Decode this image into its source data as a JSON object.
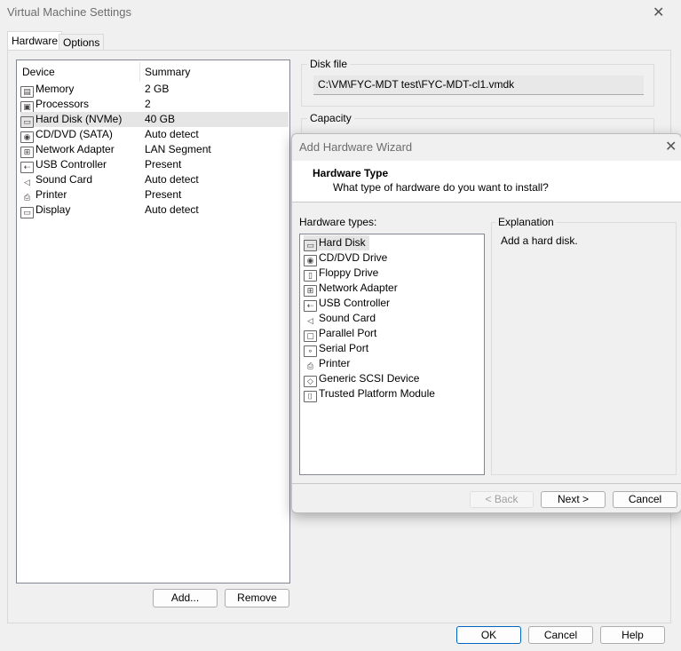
{
  "window": {
    "title": "Virtual Machine Settings",
    "close_icon": "close-icon"
  },
  "tabs": [
    {
      "label": "Hardware",
      "selected": true
    },
    {
      "label": "Options",
      "selected": false
    }
  ],
  "device_list": {
    "columns": [
      "Device",
      "Summary"
    ],
    "rows": [
      {
        "icon": "memory-icon",
        "device": "Memory",
        "summary": "2 GB"
      },
      {
        "icon": "processor-icon",
        "device": "Processors",
        "summary": "2"
      },
      {
        "icon": "hard-disk-icon",
        "device": "Hard Disk (NVMe)",
        "summary": "40 GB",
        "selected": true
      },
      {
        "icon": "cd-dvd-icon",
        "device": "CD/DVD (SATA)",
        "summary": "Auto detect"
      },
      {
        "icon": "network-adapter-icon",
        "device": "Network Adapter",
        "summary": "LAN Segment"
      },
      {
        "icon": "usb-icon",
        "device": "USB Controller",
        "summary": "Present"
      },
      {
        "icon": "sound-icon",
        "device": "Sound Card",
        "summary": "Auto detect"
      },
      {
        "icon": "printer-icon",
        "device": "Printer",
        "summary": "Present"
      },
      {
        "icon": "display-icon",
        "device": "Display",
        "summary": "Auto detect"
      }
    ]
  },
  "buttons": {
    "add": "Add...",
    "remove": "Remove",
    "ok": "OK",
    "cancel": "Cancel",
    "help": "Help"
  },
  "disk_file": {
    "label": "Disk file",
    "value": "C:\\VM\\FYC-MDT test\\FYC-MDT-cl1.vmdk"
  },
  "capacity": {
    "label": "Capacity"
  },
  "wizard": {
    "title": "Add Hardware Wizard",
    "heading": "Hardware Type",
    "subheading": "What type of hardware do you want to install?",
    "types_label": "Hardware types:",
    "types": [
      {
        "icon": "hard-disk-icon",
        "label": "Hard Disk",
        "selected": true
      },
      {
        "icon": "cd-dvd-icon",
        "label": "CD/DVD Drive"
      },
      {
        "icon": "floppy-icon",
        "label": "Floppy Drive"
      },
      {
        "icon": "network-adapter-icon",
        "label": "Network Adapter"
      },
      {
        "icon": "usb-icon",
        "label": "USB Controller"
      },
      {
        "icon": "sound-icon",
        "label": "Sound Card"
      },
      {
        "icon": "parallel-port-icon",
        "label": "Parallel Port"
      },
      {
        "icon": "serial-port-icon",
        "label": "Serial Port"
      },
      {
        "icon": "printer-icon",
        "label": "Printer"
      },
      {
        "icon": "scsi-icon",
        "label": "Generic SCSI Device"
      },
      {
        "icon": "tpm-icon",
        "label": "Trusted Platform Module"
      }
    ],
    "explanation_label": "Explanation",
    "explanation": "Add a hard disk.",
    "back": "< Back",
    "next": "Next >",
    "cancel": "Cancel"
  }
}
